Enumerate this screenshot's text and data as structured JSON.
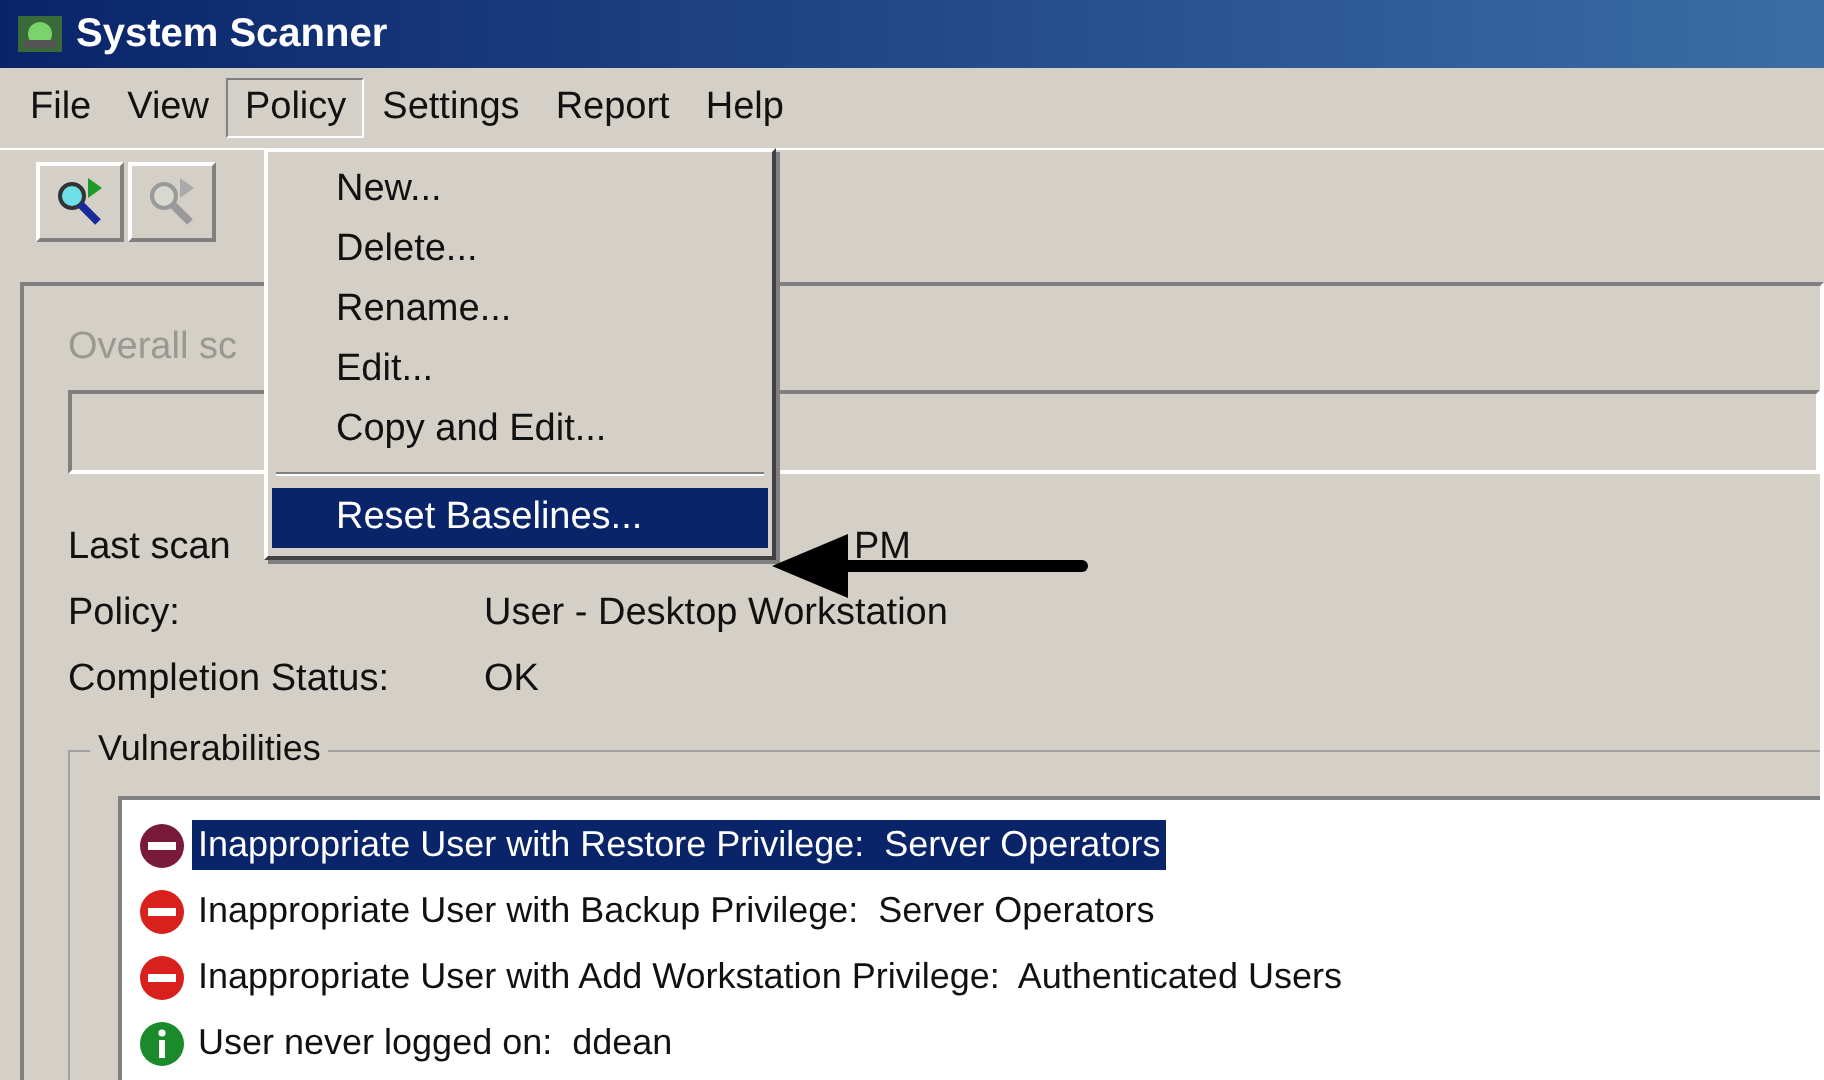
{
  "window": {
    "title": "System Scanner"
  },
  "menubar": [
    {
      "label": "File",
      "selected": false
    },
    {
      "label": "View",
      "selected": false
    },
    {
      "label": "Policy",
      "selected": true
    },
    {
      "label": "Settings",
      "selected": false
    },
    {
      "label": "Report",
      "selected": false
    },
    {
      "label": "Help",
      "selected": false
    }
  ],
  "toolbar": [
    {
      "kind": "scan",
      "disabled": false
    },
    {
      "kind": "scan",
      "disabled": true
    }
  ],
  "policy_menu": [
    {
      "label": "New...",
      "selected": false,
      "separator_before": false
    },
    {
      "label": "Delete...",
      "selected": false,
      "separator_before": false
    },
    {
      "label": "Rename...",
      "selected": false,
      "separator_before": false
    },
    {
      "label": "Edit...",
      "selected": false,
      "separator_before": false
    },
    {
      "label": "Copy and Edit...",
      "selected": false,
      "separator_before": false
    },
    {
      "label": "Reset Baselines...",
      "selected": true,
      "separator_before": true
    }
  ],
  "overall_label": "Overall sc",
  "details": [
    {
      "label": "Last scan",
      "value": "PM",
      "kind": "partial"
    },
    {
      "label": "Policy:",
      "value": "User - Desktop Workstation",
      "kind": "full"
    },
    {
      "label": "Completion Status:",
      "value": "OK",
      "kind": "full"
    }
  ],
  "vulnerabilities": {
    "title": "Vulnerabilities",
    "rows": [
      {
        "text": "Inappropriate User with Restore Privilege:  Server Operators",
        "kind": "high",
        "selected": true
      },
      {
        "text": "Inappropriate User with Backup Privilege:  Server Operators",
        "kind": "high",
        "selected": false
      },
      {
        "text": "Inappropriate User with Add Workstation Privilege:  Authenticated Users",
        "kind": "high",
        "selected": false
      },
      {
        "text": "User never logged on:  ddean",
        "kind": "info",
        "selected": false
      }
    ]
  }
}
